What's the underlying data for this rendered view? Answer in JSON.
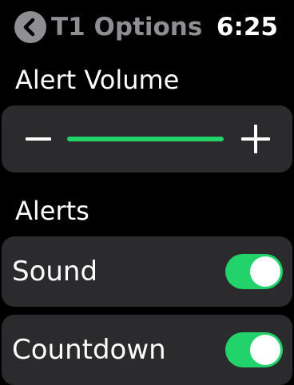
{
  "header": {
    "back_label": "T1 Options",
    "time": "6:25"
  },
  "volume": {
    "title": "Alert Volume",
    "level": 1.0,
    "minus_icon": "minus-icon",
    "plus_icon": "plus-icon"
  },
  "alerts": {
    "title": "Alerts",
    "rows": [
      {
        "label": "Sound",
        "on": true
      },
      {
        "label": "Countdown",
        "on": true
      }
    ]
  },
  "colors": {
    "accent_green": "#21d36a",
    "card_bg": "#2b2b2d",
    "back_circle": "#8e8e93",
    "back_text": "#8e8e93"
  }
}
